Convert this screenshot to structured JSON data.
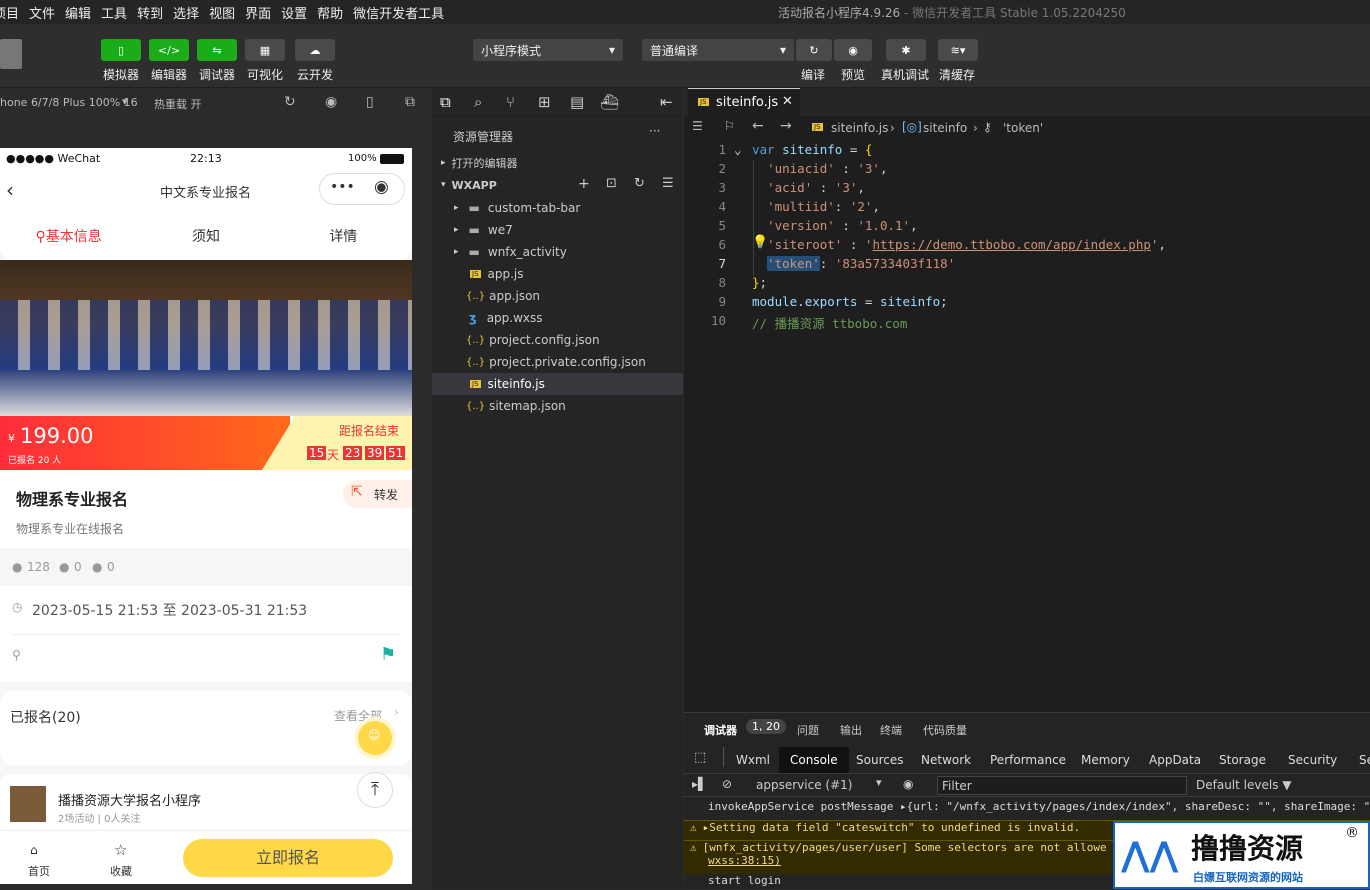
{
  "menubar": {
    "items": [
      "项目",
      "文件",
      "编辑",
      "工具",
      "转到",
      "选择",
      "视图",
      "界面",
      "设置",
      "帮助",
      "微信开发者工具"
    ],
    "title": "活动报名小程序4.9.26",
    "subtitle": "- 微信开发者工具 Stable 1.05.2204250"
  },
  "toolbar": {
    "buttons": [
      {
        "label": "模拟器",
        "icon": "phone-icon"
      },
      {
        "label": "编辑器",
        "icon": "code-icon"
      },
      {
        "label": "调试器",
        "icon": "debug-icon"
      },
      {
        "label": "可视化",
        "icon": "layout-icon"
      },
      {
        "label": "云开发",
        "icon": "cloud-icon"
      }
    ],
    "mode": "小程序模式",
    "compile": "普通编译",
    "actions": [
      {
        "label": "编译",
        "icon": "refresh-icon"
      },
      {
        "label": "预览",
        "icon": "eye-icon"
      },
      {
        "label": "真机调试",
        "icon": "bug-icon"
      },
      {
        "label": "清缓存",
        "icon": "layers-icon"
      }
    ]
  },
  "simulator": {
    "device": "hone 6/7/8 Plus 100% 16",
    "hotreload": "热重载 开"
  },
  "phone": {
    "carrier": "●●●●● WeChat",
    "time": "22:13",
    "battery": "100%",
    "nav_title": "中文系专业报名",
    "tabs": [
      "基本信息",
      "须知",
      "详情"
    ],
    "price_symbol": "¥",
    "price": "199.00",
    "signed": "已报名 20 人",
    "countdown_label": "距报名结束",
    "countdown": {
      "days": "15",
      "day_unit": "天",
      "h": "23",
      "m": "39",
      "s": "51"
    },
    "title": "物理系专业报名",
    "share": "转发",
    "desc": "物理系专业在线报名",
    "stats": [
      "128",
      "0",
      "0"
    ],
    "date_range": "2023-05-15 21:53 至 2023-05-31 21:53",
    "enrolled": "已报名(20)",
    "view_all": "查看全部",
    "org_name": "播播资源大学报名小程序",
    "org_meta": "2场活动 | 0人关注",
    "bottom": {
      "home": "首页",
      "fav": "收藏",
      "signup": "立即报名"
    }
  },
  "explorer": {
    "header": "资源管理器",
    "open_editors": "打开的编辑器",
    "root": "WXAPP",
    "items": [
      {
        "name": "custom-tab-bar",
        "type": "folder"
      },
      {
        "name": "we7",
        "type": "folder"
      },
      {
        "name": "wnfx_activity",
        "type": "folder"
      },
      {
        "name": "app.js",
        "type": "js"
      },
      {
        "name": "app.json",
        "type": "json"
      },
      {
        "name": "app.wxss",
        "type": "css"
      },
      {
        "name": "project.config.json",
        "type": "json"
      },
      {
        "name": "project.private.config.json",
        "type": "json"
      },
      {
        "name": "siteinfo.js",
        "type": "js",
        "selected": true
      },
      {
        "name": "sitemap.json",
        "type": "json"
      }
    ]
  },
  "editor": {
    "tab": "siteinfo.js",
    "breadcrumb": [
      "siteinfo.js",
      "siteinfo",
      "'token'"
    ],
    "lines": [
      "1",
      "2",
      "3",
      "4",
      "5",
      "6",
      "7",
      "8",
      "9",
      "10"
    ],
    "code": {
      "l1": "siteinfo",
      "v_uniacid": "'3'",
      "v_acid": "'3'",
      "v_multiid": "'2'",
      "v_version": "'1.0.1'",
      "v_siteroot": "https://demo.ttbobo.com/app/index.php",
      "v_token": "'83a5733403f118'",
      "comment": "// 播播资源 ttbobo.com"
    }
  },
  "devtools": {
    "top_tabs": [
      "调试器",
      "1, 20",
      "问题",
      "输出",
      "终端",
      "代码质量"
    ],
    "tabs": [
      "Wxml",
      "Console",
      "Sources",
      "Network",
      "Performance",
      "Memory",
      "AppData",
      "Storage",
      "Security",
      "Se"
    ],
    "context": "appservice (#1)",
    "filter": "Filter",
    "levels": "Default levels ▼",
    "logs": [
      {
        "text": "invokeAppService postMessage ▸{url: \"/wnfx_activity/pages/index/index\", shareDesc: \"\", shareImage: \"",
        "warn": false
      },
      {
        "text": "▸Setting data field \"cateswitch\" to undefined is invalid.",
        "warn": true
      },
      {
        "text": "[wnfx_activity/pages/user/user] Some selectors are not allowe",
        "warn": true
      },
      {
        "text": "wxss:38:15)",
        "warn": true
      },
      {
        "text": "start login",
        "warn": false
      }
    ]
  },
  "watermark": {
    "title": "撸撸资源",
    "sub": "白嫖互联网资源的网站"
  }
}
